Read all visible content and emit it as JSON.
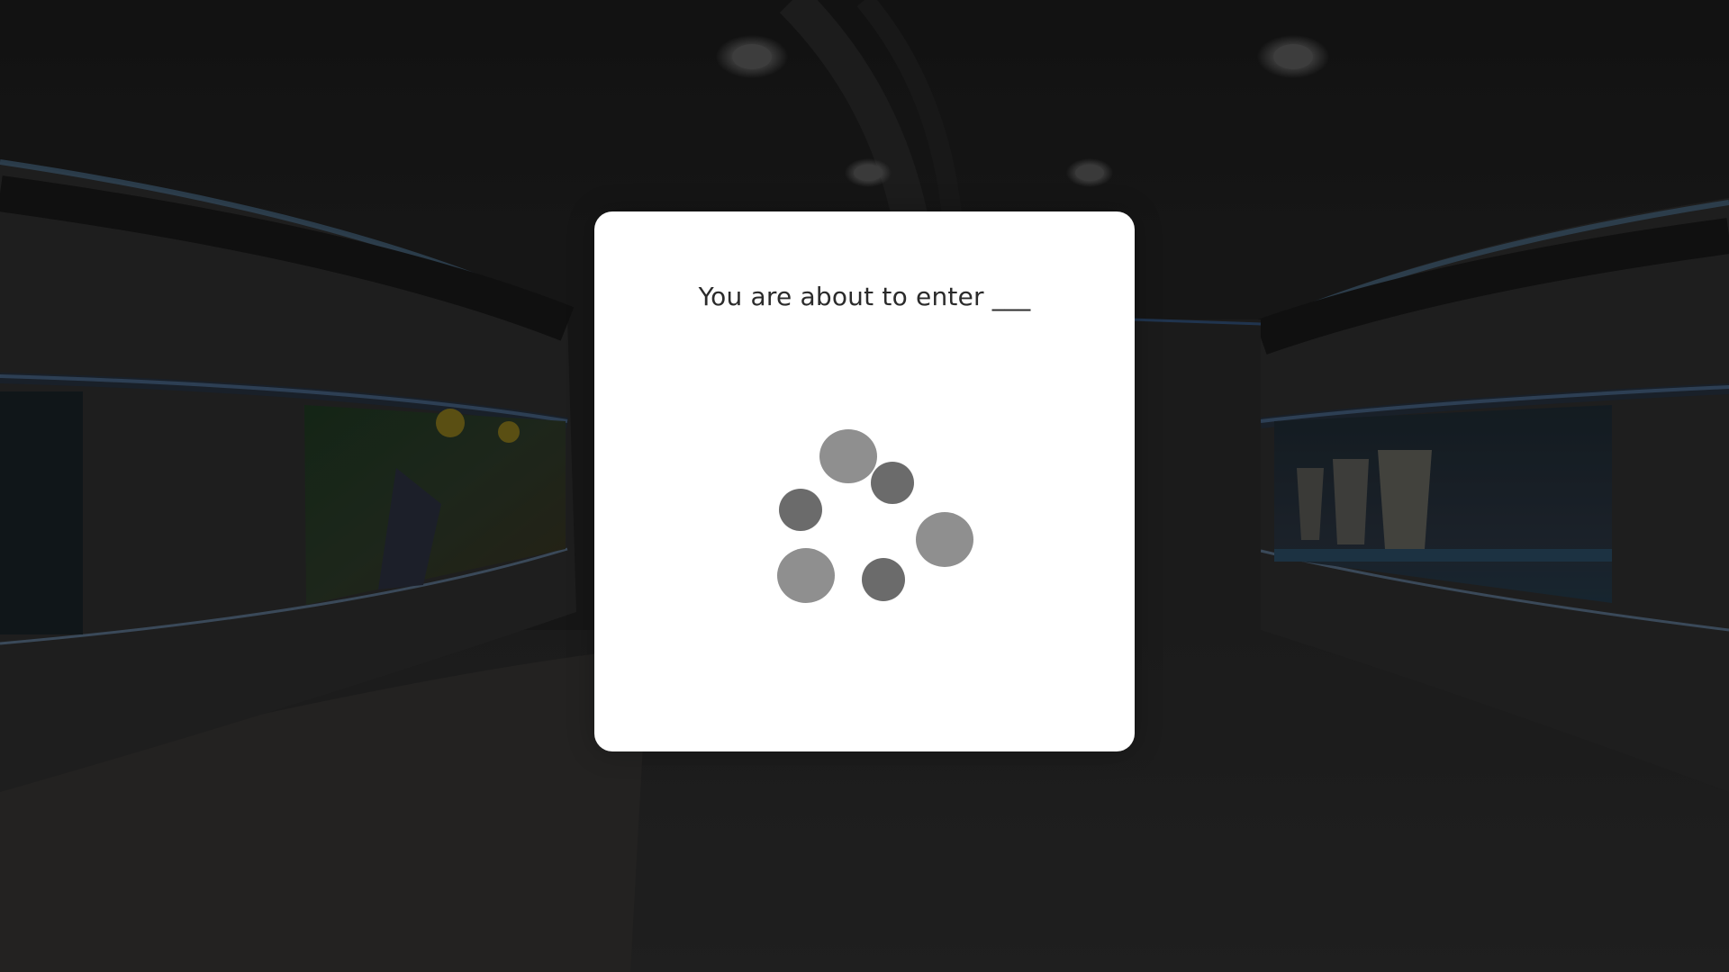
{
  "modal": {
    "title": "You are about to enter ___"
  },
  "spinner": {
    "name": "loading-spinner",
    "colors": {
      "light": "#8f8f8f",
      "dark": "#6b6b6b"
    }
  },
  "theme": {
    "background": "#222222",
    "modal_background": "#ffffff",
    "accent_glow": "#3a78c8"
  }
}
